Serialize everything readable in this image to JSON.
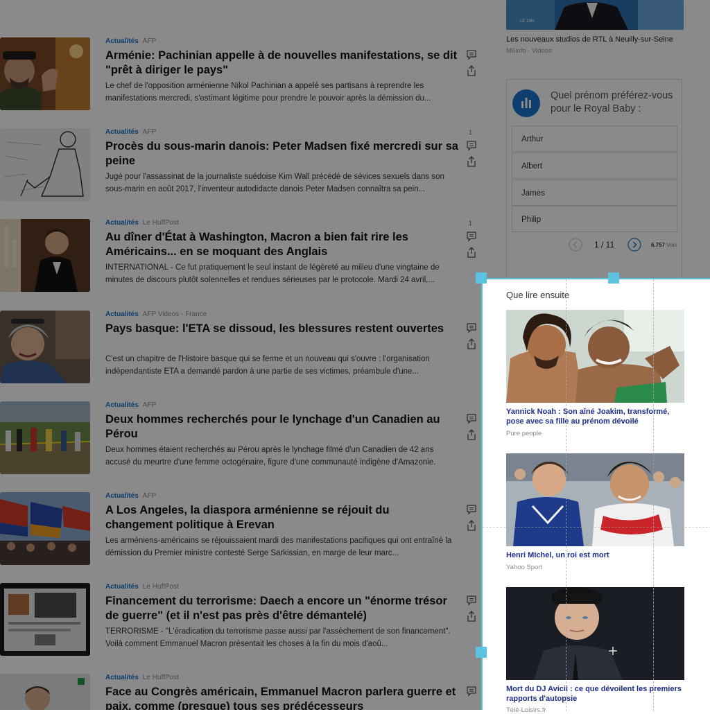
{
  "feed": [
    {
      "category": "Actualités",
      "source": "AFP",
      "title": "Arménie: Pachinian appelle à de nouvelles manifestations, se dit \"prêt à diriger le pays\"",
      "desc": "Le chef de l'opposition arménienne Nikol Pachinian a appelé ses partisans à reprendre les manifestations mercredi, s'estimant légitime pour prendre le pouvoir après la démission du...",
      "comments": ""
    },
    {
      "category": "Actualités",
      "source": "AFP",
      "title": "Procès du sous-marin danois: Peter Madsen fixé mercredi sur sa peine",
      "desc": "Jugé pour l'assassinat de la journaliste suédoise Kim Wall précédé de sévices sexuels dans son sous-marin en août 2017, l'inventeur autodidacte danois Peter Madsen connaîtra sa pein...",
      "comments": "1"
    },
    {
      "category": "Actualités",
      "source": "Le HuffPost",
      "title": "Au dîner d'État à Washington, Macron a bien fait rire les Américains... en se moquant des Anglais",
      "desc": "INTERNATIONAL - Ce fut pratiquement le seul instant de légèreté au milieu d'une vingtaine de minutes de discours plutôt solennelles et rendues sérieuses par le protocole. Mardi 24 avril,...",
      "comments": "1"
    },
    {
      "category": "Actualités",
      "source": "AFP Videos - France",
      "title": "Pays basque: l'ETA se dissoud, les blessures restent ouvertes",
      "desc": "C'est un chapitre de l'Histoire basque qui se ferme et un nouveau qui s'ouvre : l'organisation indépendantiste ETA a demandé pardon à une partie de ses victimes, préambule d'une...",
      "comments": ""
    },
    {
      "category": "Actualités",
      "source": "AFP",
      "title": "Deux hommes recherchés pour le lynchage d'un Canadien au Pérou",
      "desc": "Deux hommes étaient recherchés au Pérou après le lynchage filmé d'un Canadien de 42 ans accusé du meurtre d'une femme octogénaire, figure d'une communauté indigène d'Amazonie.",
      "comments": ""
    },
    {
      "category": "Actualités",
      "source": "AFP",
      "title": "A Los Angeles, la diaspora arménienne se réjouit du changement politique à Erevan",
      "desc": "Les arméniens-américains se réjouissaient mardi des manifestations pacifiques qui ont entraîné la démission du Premier ministre contesté Serge Sarkissian, en marge de leur marc...",
      "comments": ""
    },
    {
      "category": "Actualités",
      "source": "Le HuffPost",
      "title": "Financement du terrorisme: Daech a encore un \"énorme trésor de guerre\" (et il n'est pas près d'être démantelé)",
      "desc": "TERRORISME - \"L'éradication du terrorisme passe aussi par l'assèchement de son financement\". Voilà comment Emmanuel Macron présentait les choses à la fin du mois d'aoû...",
      "comments": ""
    },
    {
      "category": "Actualités",
      "source": "Le HuffPost",
      "title": "Face au Congrès américain, Emmanuel Macron parlera guerre et paix, comme (presque) tous ses prédécesseurs",
      "desc": "",
      "comments": ""
    }
  ],
  "top_video": {
    "title": "Les nouveaux studios de RTL à Neuilly-sur-Seine",
    "source": "M6info - Vidéos",
    "badge": "LE 10H"
  },
  "poll": {
    "question": "Quel prénom préférez-vous pour le Royal Baby :",
    "options": [
      "Arthur",
      "Albert",
      "James",
      "Philip"
    ],
    "pager": "1 / 11",
    "votes_count": "6.757",
    "votes_label": "Voix"
  },
  "next": {
    "heading": "Que lire ensuite",
    "items": [
      {
        "title": "Yannick Noah : Son aîné Joakim, transformé, pose avec sa fille au prénom dévoilé",
        "source": "Pure people"
      },
      {
        "title": "Henri Michel, un roi est mort",
        "source": "Yahoo Sport"
      },
      {
        "title": "Mort du DJ Avicii : ce que dévoilent les premiers rapports d'autopsie",
        "source": "Télé-Loisirs.fr"
      }
    ]
  },
  "colors": {
    "accent": "#1a73c9",
    "selection": "#5bc3e0",
    "link_dark": "#1d2d8a"
  }
}
